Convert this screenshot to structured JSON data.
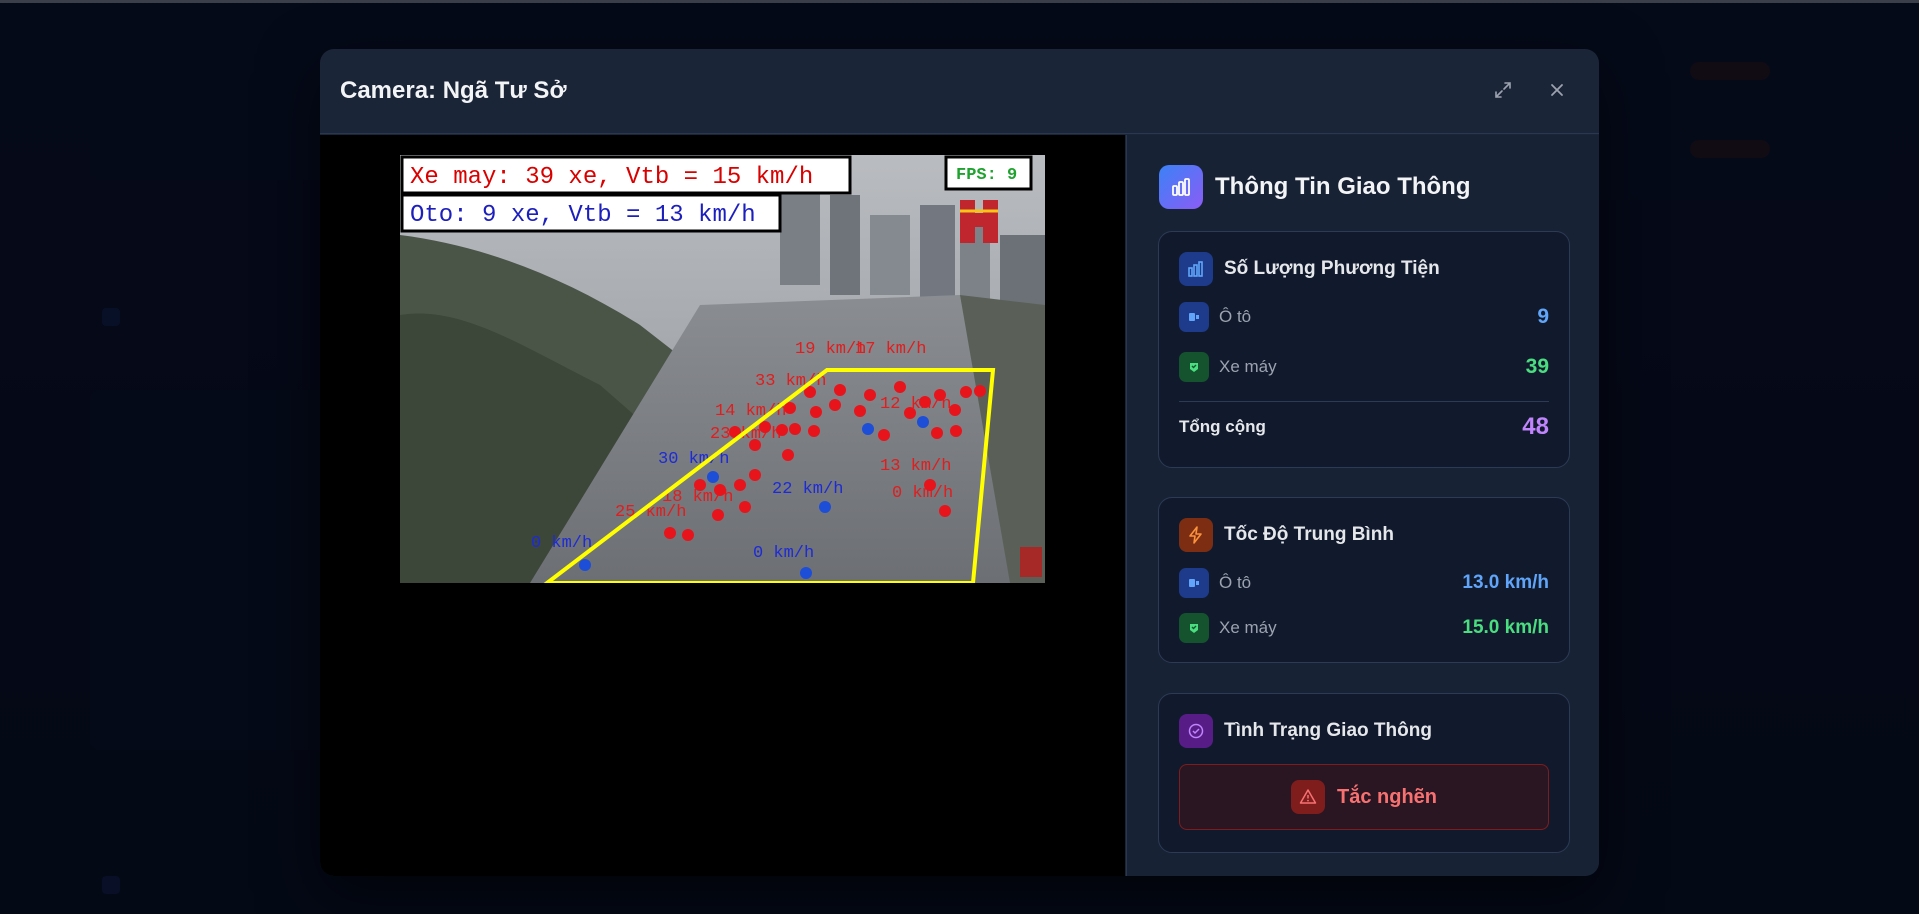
{
  "modal": {
    "title": "Camera: Ngã Tư Sở",
    "expand_icon": "expand-icon",
    "close_icon": "close-icon"
  },
  "video": {
    "overlay_moto": "Xe may: 39 xe, Vtb = 15 km/h",
    "overlay_car": "Oto: 9 xe, Vtb = 13 km/h",
    "fps": "FPS: 9",
    "speed_labels_blue": [
      "30 km/h",
      "22 km/h",
      "0 km/h",
      "0 km/h"
    ],
    "speed_labels_red": [
      "19 km/h",
      "17 km/h",
      "13 km/h",
      "0 km/h",
      "25 km/h",
      "18 km/h",
      "14 km/h",
      "23 km/h",
      "33 km/h",
      "12 km/h"
    ],
    "colors": {
      "moto": "#e11d1d",
      "car": "#1d2bd6",
      "zone": "#ffff00",
      "fps": "#22c55e"
    }
  },
  "panel": {
    "title": "Thông Tin Giao Thông",
    "title_icon": "bar-chart-icon",
    "counts": {
      "title": "Số Lượng Phương Tiện",
      "car_label": "Ô tô",
      "car_value": "9",
      "moto_label": "Xe máy",
      "moto_value": "39",
      "total_label": "Tổng cộng",
      "total_value": "48"
    },
    "speed": {
      "title": "Tốc Độ Trung Bình",
      "car_label": "Ô tô",
      "car_value": "13.0 km/h",
      "moto_label": "Xe máy",
      "moto_value": "15.0 km/h"
    },
    "status": {
      "title": "Tình Trạng Giao Thông",
      "value": "Tắc nghẽn",
      "icon": "warning-triangle-icon"
    },
    "colors": {
      "car": "#60a5fa",
      "moto": "#4ade80",
      "total": "#c084fc",
      "status": "#f87171"
    }
  }
}
